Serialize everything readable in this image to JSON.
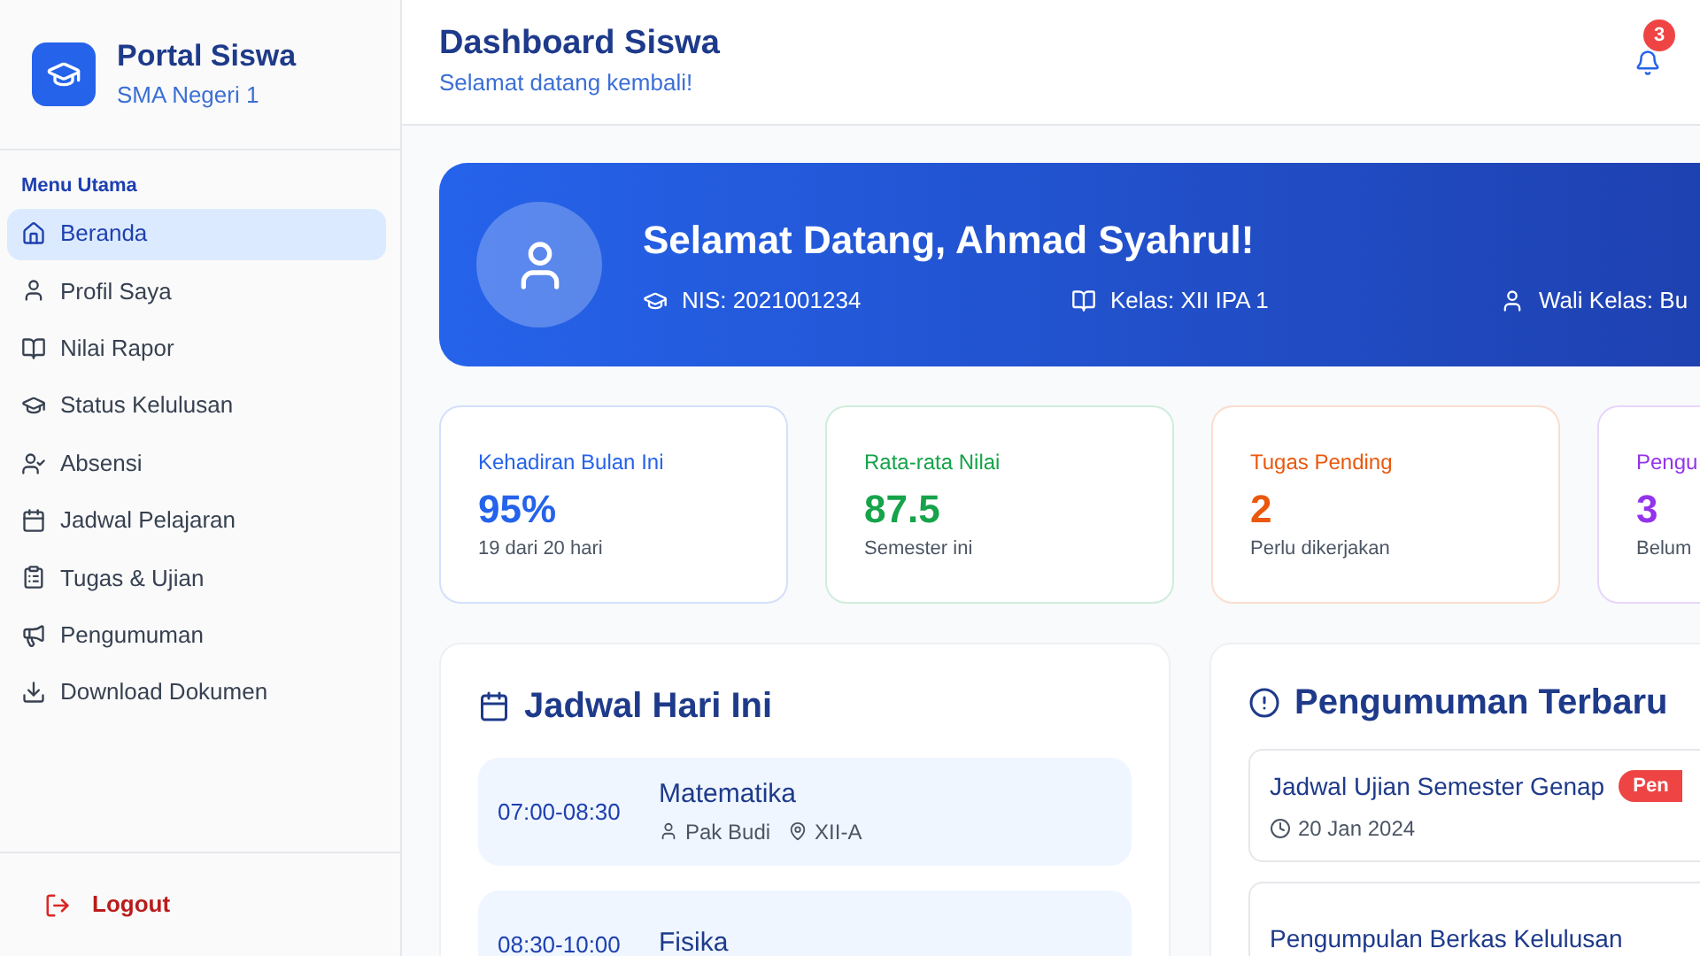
{
  "brand": {
    "title": "Portal Siswa",
    "subtitle": "SMA Negeri 1"
  },
  "sidebar": {
    "section": "Menu Utama",
    "items": [
      {
        "label": "Beranda",
        "selected": true
      },
      {
        "label": "Profil Saya",
        "selected": false
      },
      {
        "label": "Nilai Rapor",
        "selected": false
      },
      {
        "label": "Status Kelulusan",
        "selected": false
      },
      {
        "label": "Absensi",
        "selected": false
      },
      {
        "label": "Jadwal Pelajaran",
        "selected": false
      },
      {
        "label": "Tugas & Ujian",
        "selected": false
      },
      {
        "label": "Pengumuman",
        "selected": false
      },
      {
        "label": "Download Dokumen",
        "selected": false
      }
    ],
    "logout": "Logout"
  },
  "header": {
    "title": "Dashboard Siswa",
    "subtitle": "Selamat datang kembali!",
    "notifications": "3"
  },
  "banner": {
    "greeting": "Selamat Datang, Ahmad Syahrul!",
    "meta": [
      {
        "text": "NIS: 2021001234"
      },
      {
        "text": "Kelas: XII IPA 1"
      },
      {
        "text": "Wali Kelas: Bu"
      }
    ]
  },
  "stats": [
    {
      "label": "Kehadiran Bulan Ini",
      "value": "95%",
      "note": "19 dari 20 hari",
      "color": "#2563eb"
    },
    {
      "label": "Rata-rata Nilai",
      "value": "87.5",
      "note": "Semester ini",
      "color": "#16a34a"
    },
    {
      "label": "Tugas Pending",
      "value": "2",
      "note": "Perlu dikerjakan",
      "color": "#ea580c"
    },
    {
      "label": "Pengu",
      "value": "3",
      "note": "Belum",
      "color": "#9333ea"
    }
  ],
  "schedule": {
    "title": "Jadwal Hari Ini",
    "items": [
      {
        "time": "07:00-08:30",
        "subject": "Matematika",
        "teacher": "Pak Budi",
        "room": "XII-A"
      },
      {
        "time": "08:30-10:00",
        "subject": "Fisika"
      }
    ]
  },
  "announcements": {
    "title": "Pengumuman Terbaru",
    "items": [
      {
        "title": "Jadwal Ujian Semester Genap",
        "badge": "Pen",
        "date": "20 Jan 2024"
      },
      {
        "title": "Pengumpulan Berkas Kelulusan"
      }
    ]
  }
}
